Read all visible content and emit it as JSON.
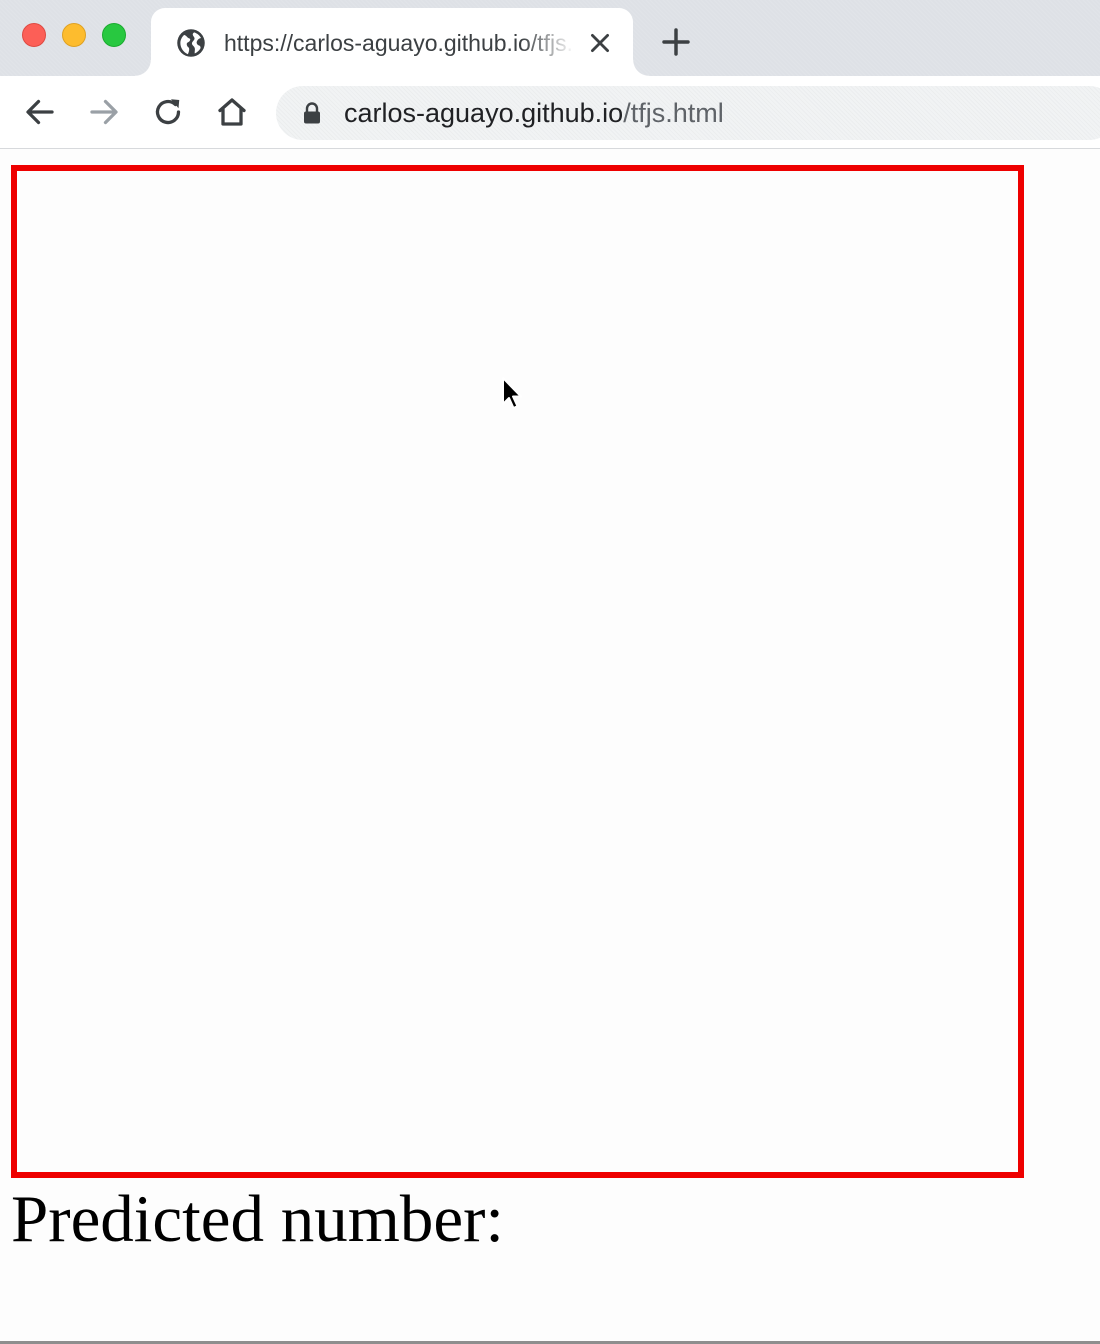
{
  "browser": {
    "tab": {
      "title": "https://carlos-aguayo.github.io/tfjs.html",
      "favicon": "globe-icon"
    },
    "toolbar": {
      "back": "arrow-left-icon",
      "forward": "arrow-right-icon",
      "reload": "reload-icon",
      "home": "home-icon"
    },
    "address_bar": {
      "lock": "lock-icon",
      "host": "carlos-aguayo.github.io",
      "path": "/tfjs.html"
    }
  },
  "page": {
    "canvas_border_color": "#ee0000",
    "prediction_label": "Predicted number:"
  },
  "colors": {
    "tab_strip": "#dee1e6",
    "close": "#fc5f57",
    "minimize": "#fdbc2e",
    "maximize": "#28c840"
  }
}
